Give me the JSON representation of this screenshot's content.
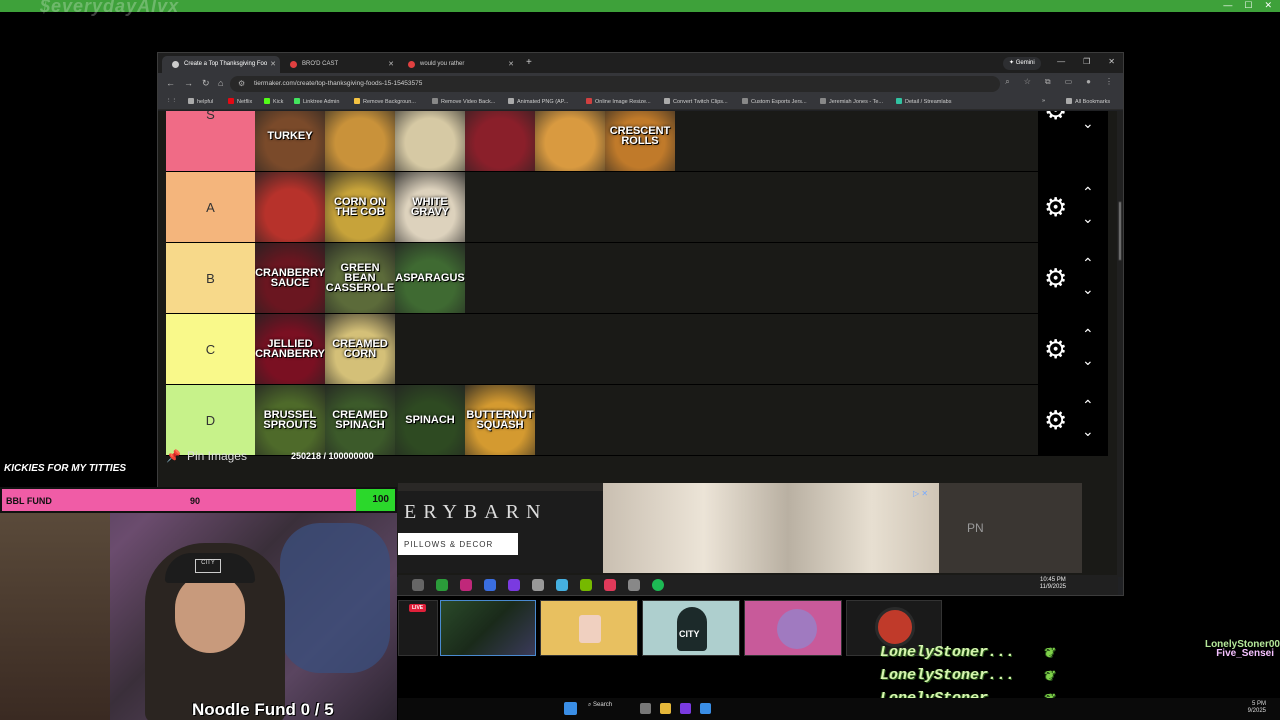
{
  "outer": {
    "ghost_title": "$everydayAlvx"
  },
  "browser": {
    "tabs": [
      {
        "label": "Create a Top Thanksgiving Foo"
      },
      {
        "label": "BRO'D CAST"
      },
      {
        "label": "would you rather"
      }
    ],
    "gemini_label": "Gemini",
    "url": "tiermaker.com/create/top-thanksgiving-foods-15-15453575",
    "bookmarks": [
      "helpful",
      "Netflix",
      "Kick",
      "Linktree Admin",
      "Remove Backgroun...",
      "Remove Video Back...",
      "Animated PNG (AP...",
      "Online Image Resize...",
      "Convert Twitch Clips...",
      "Custom Esports Jers...",
      "Jeremiah Jones - Te...",
      "Detail / Streamlabs"
    ],
    "all_bookmarks": "All Bookmarks"
  },
  "tiers": [
    {
      "label": "S",
      "color": "#f06b86",
      "items": [
        {
          "text": "Turkey",
          "bg": "#7a4a2a"
        },
        {
          "text": "",
          "bg": "#c9923a"
        },
        {
          "text": "",
          "bg": "#d6c9a4"
        },
        {
          "text": "",
          "bg": "#8a1f2a"
        },
        {
          "text": "",
          "bg": "#d99a40"
        },
        {
          "text": "Crescent Rolls",
          "bg": "#c07a2a"
        }
      ]
    },
    {
      "label": "A",
      "color": "#f4b57c",
      "items": [
        {
          "text": "",
          "bg": "#b7322b"
        },
        {
          "text": "Corn on the Cob",
          "bg": "#c7a33a"
        },
        {
          "text": "White Gravy",
          "bg": "#ddd2bd"
        }
      ]
    },
    {
      "label": "B",
      "color": "#f7d98a",
      "items": [
        {
          "text": "Cranberry Sauce",
          "bg": "#6a1620"
        },
        {
          "text": "Green Bean Casserole",
          "bg": "#5c6b3a"
        },
        {
          "text": "Asparagus",
          "bg": "#3f6a32"
        }
      ]
    },
    {
      "label": "C",
      "color": "#f9f98a",
      "items": [
        {
          "text": "Jellied Cranberry",
          "bg": "#7a1022"
        },
        {
          "text": "Creamed Corn",
          "bg": "#d4c078"
        }
      ]
    },
    {
      "label": "D",
      "color": "#c7f28a",
      "items": [
        {
          "text": "Brussel Sprouts",
          "bg": "#4e6a2a"
        },
        {
          "text": "Creamed Spinach",
          "bg": "#3c5a2a"
        },
        {
          "text": "Spinach",
          "bg": "#2e4a22"
        },
        {
          "text": "Butternut Squash",
          "bg": "#d49a30"
        }
      ]
    }
  ],
  "pin": {
    "label": "Pin Images",
    "counter": "250218 / 100000000"
  },
  "ad": {
    "brand": "ERYBARN",
    "cta": "PILLOWS & DECOR",
    "right_text": "PN"
  },
  "inner_clock": {
    "time": "10:45 PM",
    "date": "11/9/2025"
  },
  "overlay": {
    "kick_text": "KICKIES FOR MY TITTIES",
    "bbl_label": "BBL FUND",
    "bbl_current": "90",
    "bbl_goal": "100",
    "bbl_progress": 0.9,
    "hat_text": "CITY",
    "noodle": "Noodle Fund 0 / 5"
  },
  "thumbs": {
    "live": "LIVE",
    "city_label": "CITY"
  },
  "chat": [
    {
      "name": "LonelyStoner..."
    },
    {
      "name": "LonelyStoner..."
    },
    {
      "name": "LonelyStoner..."
    }
  ],
  "names": {
    "first": "LonelyStoner00",
    "second": "Five_Sensei"
  },
  "taskbar": {
    "search": "Search",
    "time": "5 PM",
    "date": "9/2025"
  }
}
